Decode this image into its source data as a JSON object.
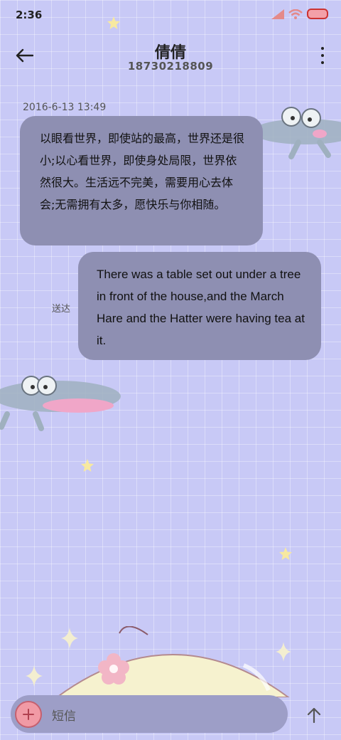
{
  "status_bar": {
    "time": "2:36"
  },
  "header": {
    "contact_name": "倩倩",
    "contact_number": "18730218809"
  },
  "conversation": {
    "timestamp": "2016-6-13 13:49",
    "messages": [
      {
        "direction": "incoming",
        "text": "以眼看世界，即使站的最高，世界还是很小;以心看世界，即使身处局限，世界依然很大。生活远不完美，需要用心去体会;无需拥有太多，愿快乐与你相随。"
      },
      {
        "direction": "outgoing",
        "text": "There was a table set out under a tree in front of the house,and the March Hare and the Hatter were having tea at it.",
        "status": "送达"
      }
    ]
  },
  "composer": {
    "placeholder": "短信"
  },
  "colors": {
    "background": "#c8c9f6",
    "bubble": "#8e8fb2",
    "accent": "#f19aa5"
  },
  "icons": [
    "back-arrow-icon",
    "more-vert-icon",
    "plus-icon",
    "send-arrow-icon",
    "signal-icon",
    "wifi-icon",
    "battery-icon"
  ]
}
